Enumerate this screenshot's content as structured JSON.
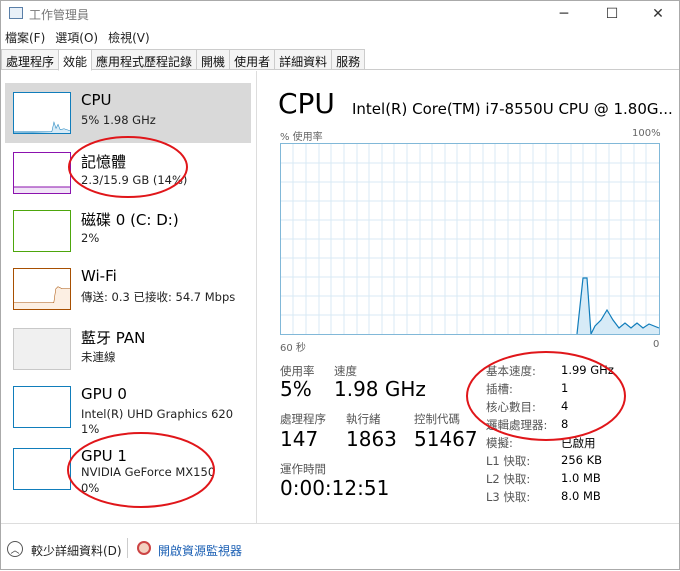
{
  "window": {
    "title": "工作管理員",
    "minimize": "─",
    "maximize": "☐",
    "close": "✕"
  },
  "menu": [
    "檔案(F)",
    "選項(O)",
    "檢視(V)"
  ],
  "tabs": [
    "處理程序",
    "效能",
    "應用程式歷程記錄",
    "開機",
    "使用者",
    "詳細資料",
    "服務"
  ],
  "resources": [
    {
      "name": "CPU",
      "line1": "5%  1.98 GHz",
      "line2": "",
      "color": "#117dbb"
    },
    {
      "name": "記憶體",
      "line1": "2.3/15.9 GB (14%)",
      "line2": "",
      "color": "#8b12ae"
    },
    {
      "name": "磁碟 0 (C: D:)",
      "line1": "2%",
      "line2": "",
      "color": "#4da60c"
    },
    {
      "name": "Wi-Fi",
      "line1": "傳送: 0.3  已接收: 54.7 Mbps",
      "line2": "",
      "color": "#a74f01"
    },
    {
      "name": "藍牙 PAN",
      "line1": "未連線",
      "line2": "",
      "color": "#a0a0a0"
    },
    {
      "name": "GPU 0",
      "line1": "Intel(R) UHD Graphics 620",
      "line2": "1%",
      "color": "#117dbb"
    },
    {
      "name": "GPU 1",
      "line1": "NVIDIA GeForce MX150",
      "line2": "0%",
      "color": "#117dbb"
    }
  ],
  "detail": {
    "title": "CPU",
    "model": "Intel(R) Core(TM) i7-8550U CPU @ 1.80G...",
    "graph_top_left": "% 使用率",
    "graph_top_right": "100%",
    "graph_bottom_left": "60 秒",
    "graph_bottom_right": "0",
    "usage_label": "使用率",
    "usage": "5%",
    "speed_label": "速度",
    "speed": "1.98 GHz",
    "processes_label": "處理程序",
    "processes": "147",
    "threads_label": "執行緒",
    "threads": "1863",
    "handles_label": "控制代碼",
    "handles": "51467",
    "uptime_label": "運作時間",
    "uptime": "0:00:12:51",
    "specs": [
      {
        "label": "基本速度:",
        "value": "1.99 GHz"
      },
      {
        "label": "插槽:",
        "value": "1"
      },
      {
        "label": "核心數目:",
        "value": "4"
      },
      {
        "label": "邏輯處理器:",
        "value": "8"
      },
      {
        "label": "模擬:",
        "value": "已啟用"
      },
      {
        "label": "L1 快取:",
        "value": "256 KB"
      },
      {
        "label": "L2 快取:",
        "value": "1.0 MB"
      },
      {
        "label": "L3 快取:",
        "value": "8.0 MB"
      }
    ]
  },
  "bottom": {
    "less_details": "較少詳細資料(D)",
    "open_monitor": "開啟資源監視器"
  },
  "colors": {
    "cpu_line": "#117dbb",
    "annotation": "#e0161a"
  }
}
